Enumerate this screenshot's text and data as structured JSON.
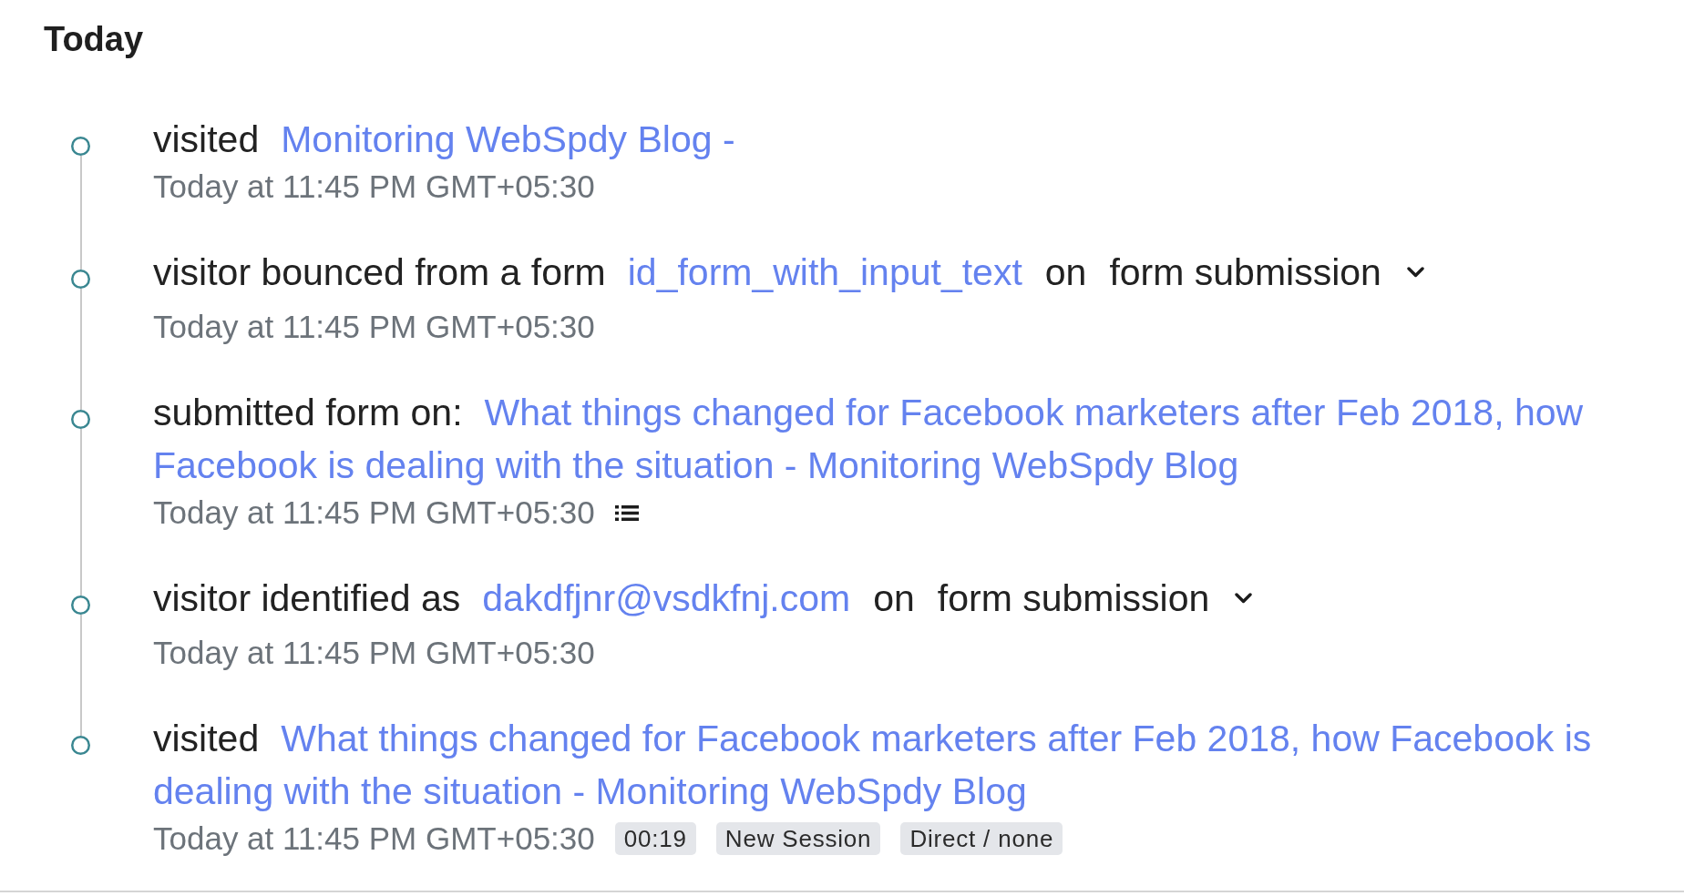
{
  "heading": "Today",
  "events": [
    {
      "action": "visited",
      "link": "Monitoring WebSpdy Blog -",
      "time": "Today at 11:45 PM GMT+05:30",
      "has_details": false
    },
    {
      "action": "visitor bounced from a form",
      "link": "id_form_with_input_text",
      "connector": "on",
      "trigger": "form submission",
      "time": "Today at 11:45 PM GMT+05:30",
      "has_details": false
    },
    {
      "action": "submitted form on:",
      "link": "What things changed for Facebook marketers after Feb 2018, how Facebook is dealing with the situation - Monitoring WebSpdy Blog",
      "time": "Today at 11:45 PM GMT+05:30",
      "has_details": true
    },
    {
      "action": "visitor identified as",
      "link": "dakdfjnr@vsdkfnj.com",
      "connector": "on",
      "trigger": "form submission",
      "time": "Today at 11:45 PM GMT+05:30",
      "has_details": false
    },
    {
      "action": "visited",
      "link": "What things changed for Facebook marketers after Feb 2018, how Facebook is dealing with the situation - Monitoring WebSpdy Blog",
      "time": "Today at 11:45 PM GMT+05:30",
      "has_details": false,
      "tags": [
        "00:19",
        "New Session",
        "Direct / none"
      ]
    }
  ]
}
